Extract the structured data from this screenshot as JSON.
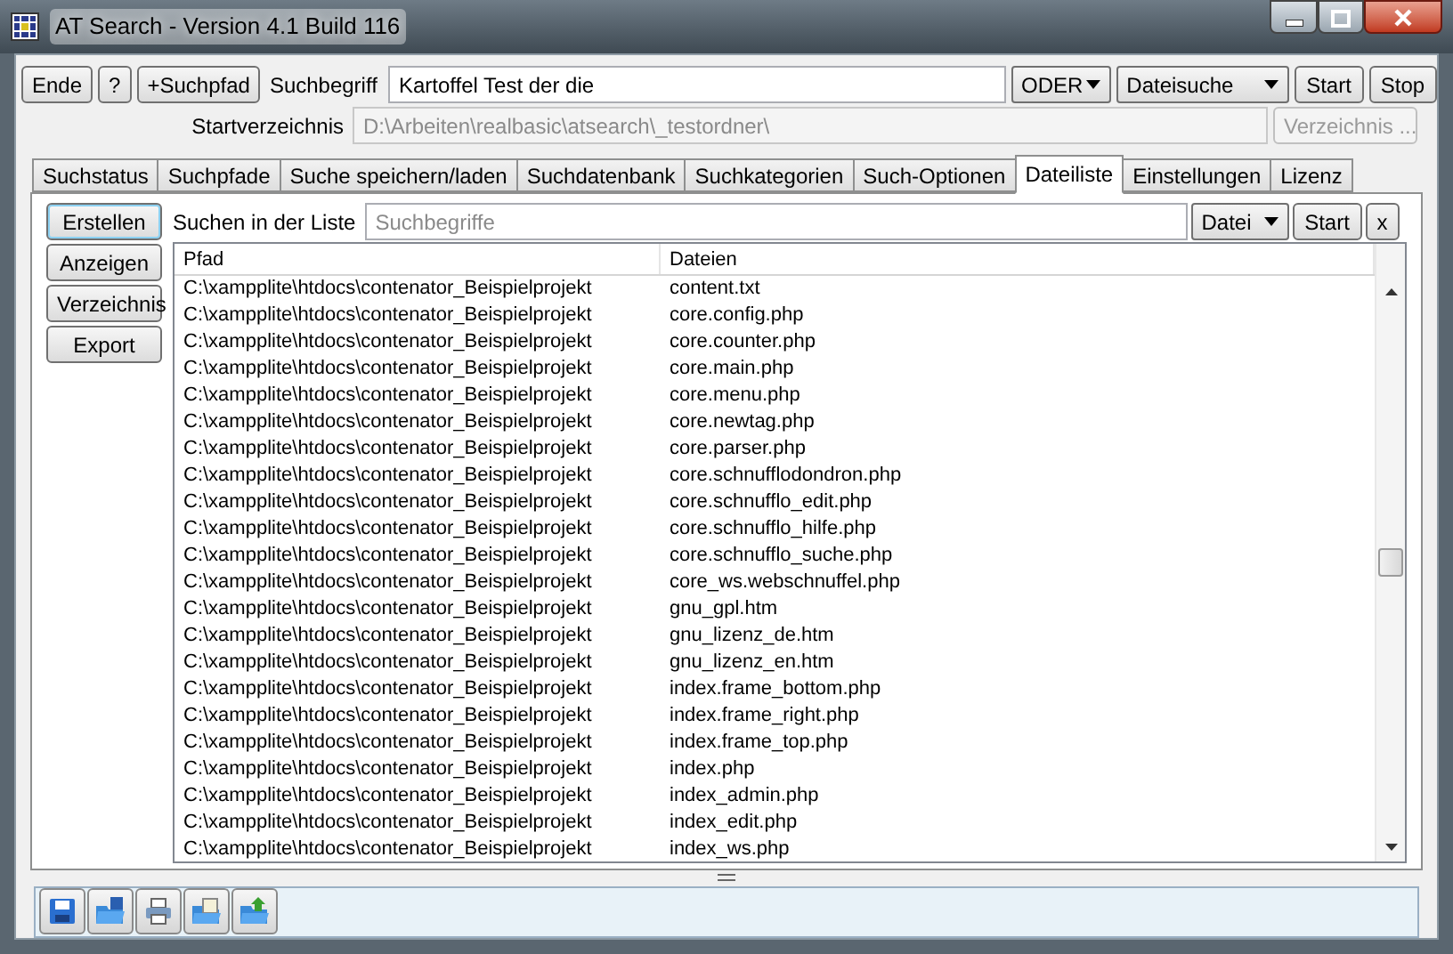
{
  "window": {
    "title": "AT Search - Version 4.1 Build 116"
  },
  "top_buttons": [
    "Ende",
    "?",
    "+Suchpfad"
  ],
  "search": {
    "label": "Suchbegriff",
    "value": "Kartoffel Test der die",
    "mode": "ODER",
    "type": "Dateisuche",
    "start": "Start",
    "stop": "Stop"
  },
  "start_dir": {
    "label": "Startverzeichnis",
    "value": "D:\\Arbeiten\\realbasic\\atsearch\\_testordner\\",
    "button": "Verzeichnis ...",
    "disabled": true
  },
  "tabs": [
    {
      "label": "Suchstatus",
      "selected": false
    },
    {
      "label": "Suchpfade",
      "selected": false
    },
    {
      "label": "Suche speichern/laden",
      "selected": false
    },
    {
      "label": "Suchdatenbank",
      "selected": false
    },
    {
      "label": "Suchkategorien",
      "selected": false
    },
    {
      "label": "Such-Optionen",
      "selected": false
    },
    {
      "label": "Dateiliste",
      "selected": true
    },
    {
      "label": "Einstellungen",
      "selected": false
    },
    {
      "label": "Lizenz",
      "selected": false
    }
  ],
  "side_buttons": [
    {
      "label": "Erstellen",
      "focused": true
    },
    {
      "label": "Anzeigen",
      "focused": false
    },
    {
      "label": "Verzeichnis",
      "focused": false
    },
    {
      "label": "Export",
      "focused": false
    }
  ],
  "list_search": {
    "label": "Suchen in der Liste",
    "placeholder": "Suchbegriffe",
    "scope": "Datei",
    "start": "Start",
    "clear": "x"
  },
  "table": {
    "columns": [
      "Pfad",
      "Dateien"
    ],
    "rows": [
      [
        "C:\\xampplite\\htdocs\\contenator_Beispielprojekt",
        "content.txt"
      ],
      [
        "C:\\xampplite\\htdocs\\contenator_Beispielprojekt",
        "core.config.php"
      ],
      [
        "C:\\xampplite\\htdocs\\contenator_Beispielprojekt",
        "core.counter.php"
      ],
      [
        "C:\\xampplite\\htdocs\\contenator_Beispielprojekt",
        "core.main.php"
      ],
      [
        "C:\\xampplite\\htdocs\\contenator_Beispielprojekt",
        "core.menu.php"
      ],
      [
        "C:\\xampplite\\htdocs\\contenator_Beispielprojekt",
        "core.newtag.php"
      ],
      [
        "C:\\xampplite\\htdocs\\contenator_Beispielprojekt",
        "core.parser.php"
      ],
      [
        "C:\\xampplite\\htdocs\\contenator_Beispielprojekt",
        "core.schnufflodondron.php"
      ],
      [
        "C:\\xampplite\\htdocs\\contenator_Beispielprojekt",
        "core.schnufflo_edit.php"
      ],
      [
        "C:\\xampplite\\htdocs\\contenator_Beispielprojekt",
        "core.schnufflo_hilfe.php"
      ],
      [
        "C:\\xampplite\\htdocs\\contenator_Beispielprojekt",
        "core.schnufflo_suche.php"
      ],
      [
        "C:\\xampplite\\htdocs\\contenator_Beispielprojekt",
        "core_ws.webschnuffel.php"
      ],
      [
        "C:\\xampplite\\htdocs\\contenator_Beispielprojekt",
        "gnu_gpl.htm"
      ],
      [
        "C:\\xampplite\\htdocs\\contenator_Beispielprojekt",
        "gnu_lizenz_de.htm"
      ],
      [
        "C:\\xampplite\\htdocs\\contenator_Beispielprojekt",
        "gnu_lizenz_en.htm"
      ],
      [
        "C:\\xampplite\\htdocs\\contenator_Beispielprojekt",
        "index.frame_bottom.php"
      ],
      [
        "C:\\xampplite\\htdocs\\contenator_Beispielprojekt",
        "index.frame_right.php"
      ],
      [
        "C:\\xampplite\\htdocs\\contenator_Beispielprojekt",
        "index.frame_top.php"
      ],
      [
        "C:\\xampplite\\htdocs\\contenator_Beispielprojekt",
        "index.php"
      ],
      [
        "C:\\xampplite\\htdocs\\contenator_Beispielprojekt",
        "index_admin.php"
      ],
      [
        "C:\\xampplite\\htdocs\\contenator_Beispielprojekt",
        "index_edit.php"
      ],
      [
        "C:\\xampplite\\htdocs\\contenator_Beispielprojekt",
        "index_ws.php"
      ]
    ]
  }
}
